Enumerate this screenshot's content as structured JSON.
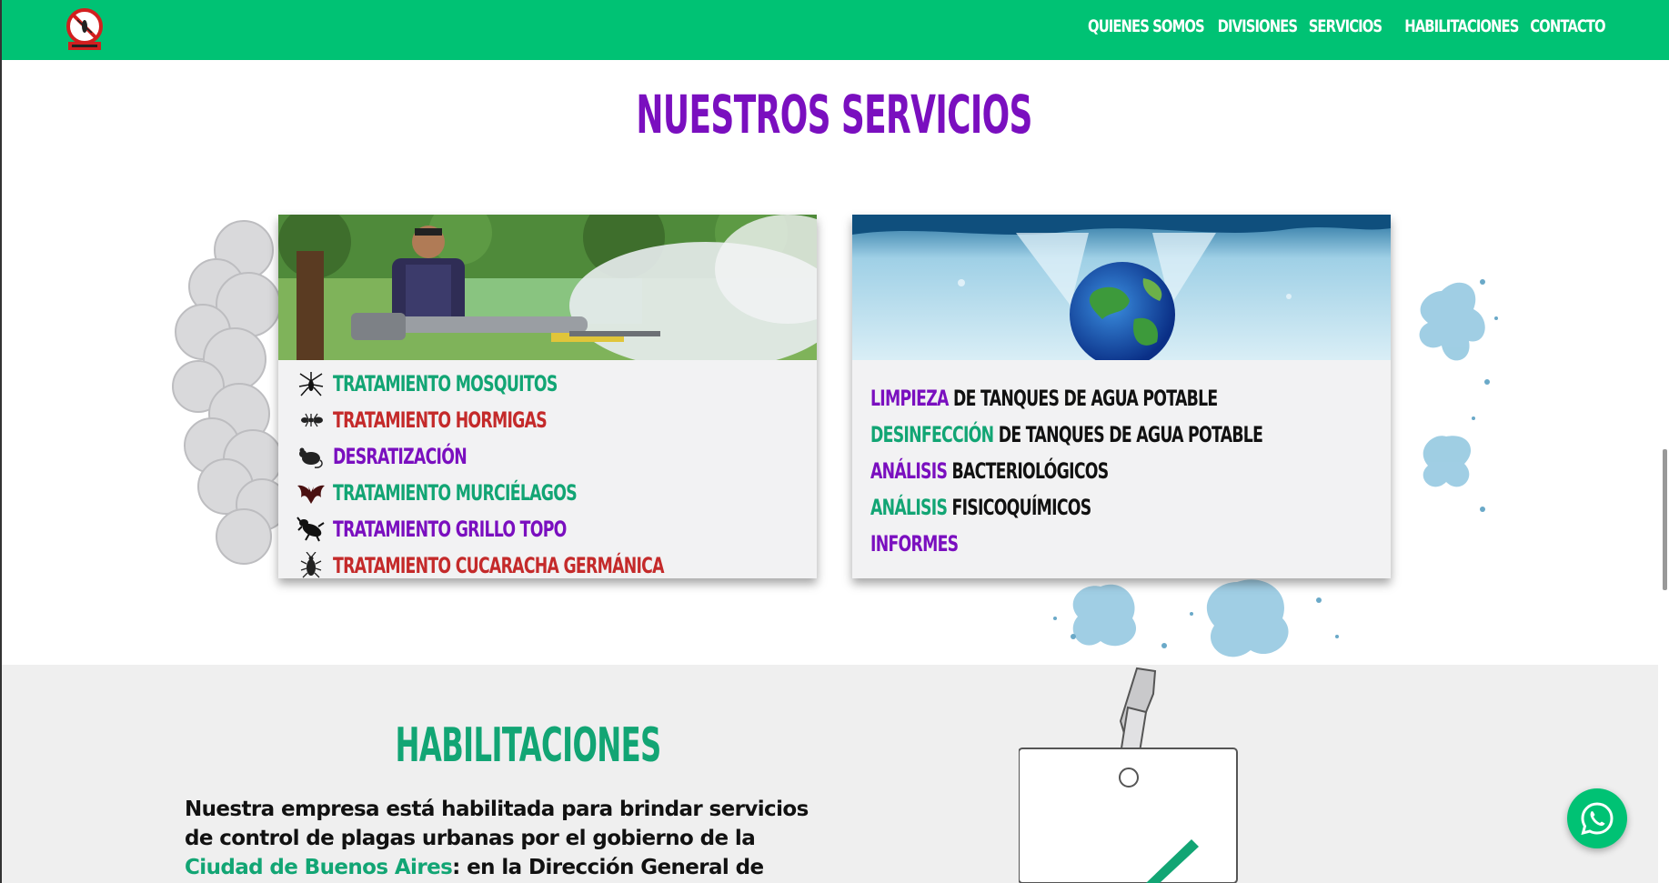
{
  "header": {
    "logo_icon": "no-mosquito-logo",
    "nav": [
      {
        "label": "QUIENES SOMOS"
      },
      {
        "label": "DIVISIONES"
      },
      {
        "label": "SERVICIOS"
      },
      {
        "label": "HABILITACIONES"
      },
      {
        "label": "CONTACTO"
      }
    ]
  },
  "servicios": {
    "title": "NUESTROS SERVICIOS",
    "pest_card": {
      "image": "worker-fumigating-photo",
      "items": [
        {
          "label": "TRATAMIENTO MOSQUITOS",
          "icon": "mosquito-icon",
          "color": "#12a574"
        },
        {
          "label": "TRATAMIENTO HORMIGAS",
          "icon": "ant-icon",
          "color": "#c42a2a"
        },
        {
          "label": "DESRATIZACIÓN",
          "icon": "rat-icon",
          "color": "#7a0fbf"
        },
        {
          "label": "TRATAMIENTO MURCIÉLAGOS",
          "icon": "bat-icon",
          "color": "#12a574"
        },
        {
          "label": "TRATAMIENTO GRILLO TOPO",
          "icon": "mole-cricket-icon",
          "color": "#7a0fbf"
        },
        {
          "label": "TRATAMIENTO CUCARACHA GERMÁNICA",
          "icon": "cockroach-icon",
          "color": "#c42a2a"
        }
      ]
    },
    "water_card": {
      "image": "globe-splashing-water-photo",
      "items": [
        {
          "accent": "LIMPIEZA",
          "rest": " DE TANQUES DE AGUA POTABLE",
          "accent_color": "#7a0fbf"
        },
        {
          "accent": "DESINFECCIÓN",
          "rest": " DE TANQUES DE AGUA POTABLE",
          "accent_color": "#12a574"
        },
        {
          "accent": "ANÁLISIS",
          "rest": " BACTERIOLÓGICOS",
          "accent_color": "#7a0fbf"
        },
        {
          "accent": "ANÁLISIS",
          "rest": " FISICOQUÍMICOS",
          "accent_color": "#12a574"
        },
        {
          "accent": "INFORMES",
          "rest": "",
          "accent_color": "#7a0fbf"
        }
      ]
    }
  },
  "habilitaciones": {
    "title": "HABILITACIONES",
    "text_before": "Nuestra empresa está habilitada para brindar servicios de control de plagas urbanas por el gobierno de la ",
    "link": "Ciudad de Buenos Aires",
    "text_after": ": en la Dirección General de Control Ambiental.",
    "badge_icon": "id-badge-clip-icon"
  },
  "whatsapp": {
    "icon": "whatsapp-icon"
  },
  "colors": {
    "brand_green": "#00c274",
    "purple": "#7a0fbf",
    "green_text": "#12a574",
    "red": "#c42a2a"
  }
}
